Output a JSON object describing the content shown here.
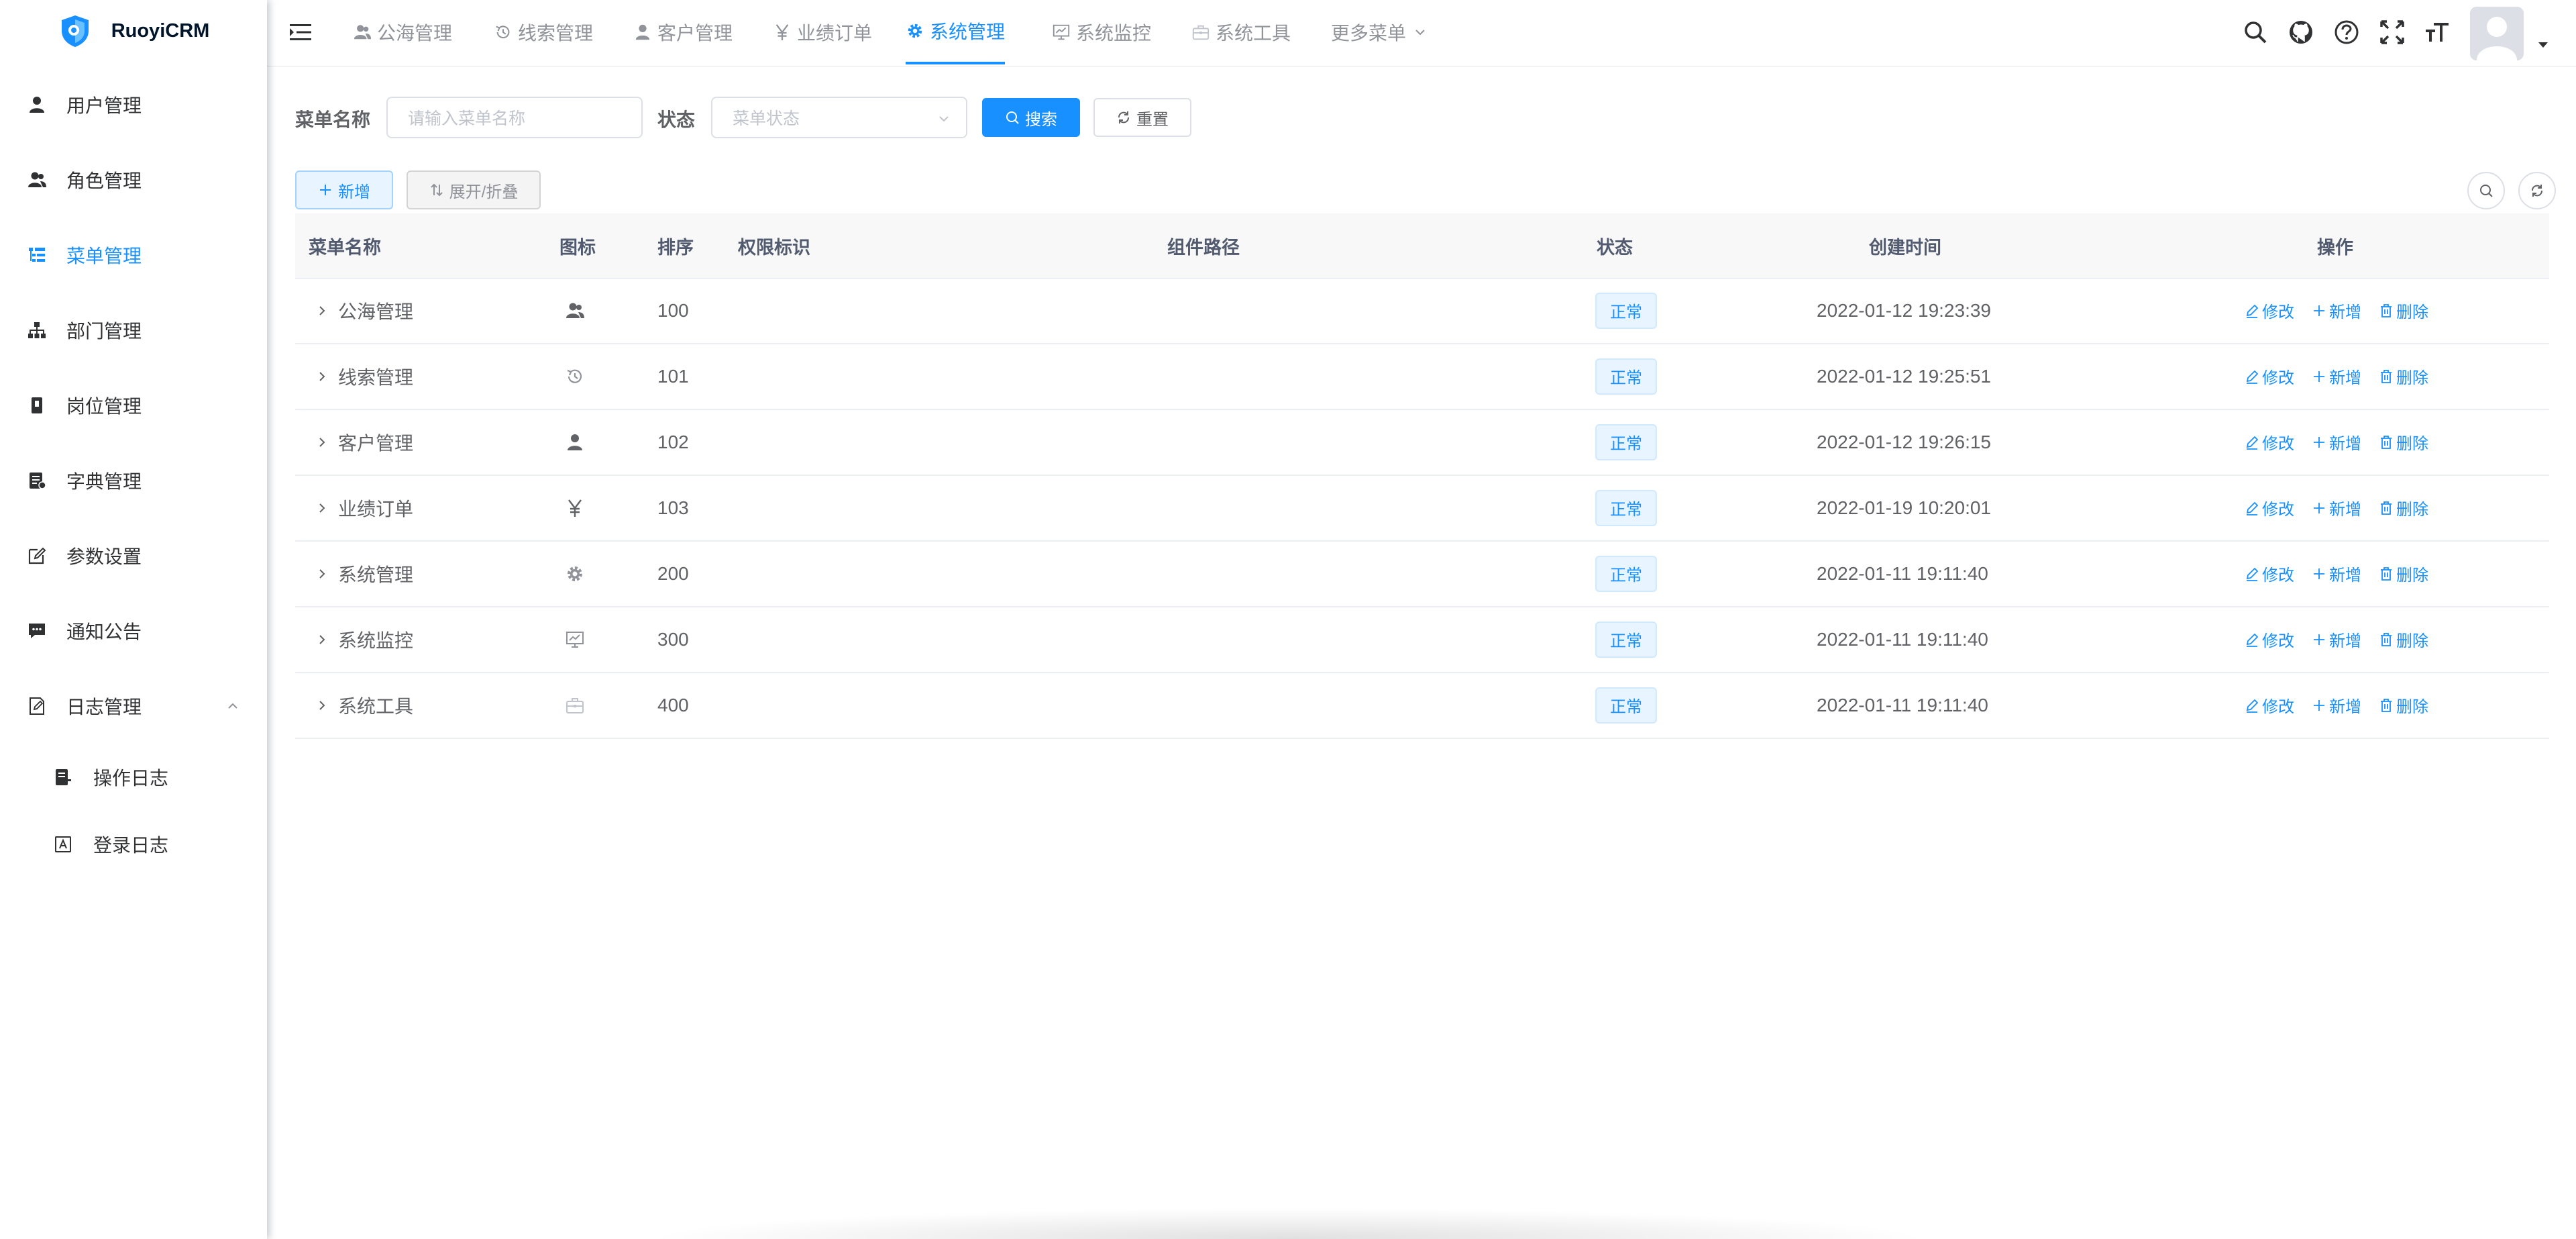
{
  "app": {
    "brand": "RuoyiCRM"
  },
  "colors": {
    "primary": "#1890ff",
    "sidebar_bg": "#ffffff",
    "text": "#303133"
  },
  "sidebar": {
    "items": [
      {
        "label": "用户管理",
        "icon": "user-icon"
      },
      {
        "label": "角色管理",
        "icon": "peoples-icon"
      },
      {
        "label": "菜单管理",
        "icon": "tree-table-icon",
        "active": true
      },
      {
        "label": "部门管理",
        "icon": "tree-icon"
      },
      {
        "label": "岗位管理",
        "icon": "post-icon"
      },
      {
        "label": "字典管理",
        "icon": "dict-icon"
      },
      {
        "label": "参数设置",
        "icon": "edit-icon"
      },
      {
        "label": "通知公告",
        "icon": "message-icon"
      },
      {
        "label": "日志管理",
        "icon": "log-icon",
        "expanded": true
      }
    ],
    "subitems": [
      {
        "label": "操作日志",
        "icon": "form-icon"
      },
      {
        "label": "登录日志",
        "icon": "logininfor-icon"
      }
    ]
  },
  "topnav": {
    "items": [
      {
        "label": "公海管理",
        "icon": "peoples-icon"
      },
      {
        "label": "线索管理",
        "icon": "history-icon"
      },
      {
        "label": "客户管理",
        "icon": "user-icon"
      },
      {
        "label": "业绩订单",
        "icon": "yen-icon"
      },
      {
        "label": "系统管理",
        "icon": "system-icon",
        "active": true
      },
      {
        "label": "系统监控",
        "icon": "monitor-icon"
      },
      {
        "label": "系统工具",
        "icon": "tool-icon"
      },
      {
        "label": "更多菜单",
        "icon": "chevron-down-icon"
      }
    ],
    "right_icons": [
      "search-icon",
      "github-icon",
      "question-icon",
      "fullscreen-icon",
      "size-icon"
    ]
  },
  "search": {
    "name_label": "菜单名称",
    "name_placeholder": "请输入菜单名称",
    "status_label": "状态",
    "status_placeholder": "菜单状态",
    "search_btn": "搜索",
    "reset_btn": "重置"
  },
  "toolbar": {
    "add_btn": "新增",
    "expand_btn": "展开/折叠"
  },
  "table": {
    "columns": [
      "菜单名称",
      "图标",
      "排序",
      "权限标识",
      "组件路径",
      "状态",
      "创建时间",
      "操作"
    ],
    "rows": [
      {
        "name": "公海管理",
        "icon": "peoples-icon",
        "order": "100",
        "perms": "",
        "component": "",
        "status": "正常",
        "created": "2022-01-12 19:23:39"
      },
      {
        "name": "线索管理",
        "icon": "history-icon",
        "order": "101",
        "perms": "",
        "component": "",
        "status": "正常",
        "created": "2022-01-12 19:25:51"
      },
      {
        "name": "客户管理",
        "icon": "user-icon",
        "order": "102",
        "perms": "",
        "component": "",
        "status": "正常",
        "created": "2022-01-12 19:26:15"
      },
      {
        "name": "业绩订单",
        "icon": "yen-icon",
        "order": "103",
        "perms": "",
        "component": "",
        "status": "正常",
        "created": "2022-01-19 10:20:01"
      },
      {
        "name": "系统管理",
        "icon": "system-icon",
        "order": "200",
        "perms": "",
        "component": "",
        "status": "正常",
        "created": "2022-01-11 19:11:40"
      },
      {
        "name": "系统监控",
        "icon": "monitor-icon",
        "order": "300",
        "perms": "",
        "component": "",
        "status": "正常",
        "created": "2022-01-11 19:11:40"
      },
      {
        "name": "系统工具",
        "icon": "tool-icon",
        "order": "400",
        "perms": "",
        "component": "",
        "status": "正常",
        "created": "2022-01-11 19:11:40"
      }
    ],
    "actions": {
      "edit": "修改",
      "add": "新增",
      "delete": "删除"
    }
  }
}
